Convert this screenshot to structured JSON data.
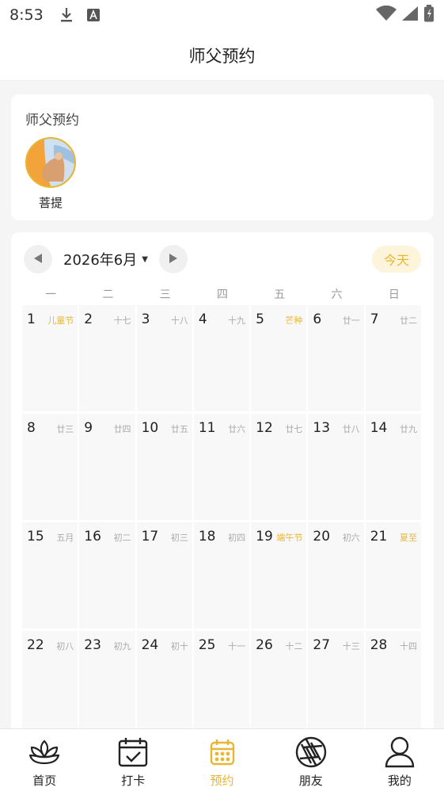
{
  "status_bar": {
    "time": "8:53",
    "icons": [
      "download-icon",
      "a-icon",
      "wifi-icon",
      "signal-icon",
      "battery-icon"
    ]
  },
  "header": {
    "title": "师父预约"
  },
  "master_section": {
    "title": "师父预约",
    "masters": [
      {
        "name": "菩提"
      }
    ]
  },
  "calendar": {
    "month_label": "2026年6月",
    "today_label": "今天",
    "weekdays": [
      "一",
      "二",
      "三",
      "四",
      "五",
      "六",
      "日"
    ],
    "weeks": [
      [
        {
          "day": "1",
          "lunar": "儿童节",
          "festival": true
        },
        {
          "day": "2",
          "lunar": "十七"
        },
        {
          "day": "3",
          "lunar": "十八"
        },
        {
          "day": "4",
          "lunar": "十九"
        },
        {
          "day": "5",
          "lunar": "芒种",
          "festival": true
        },
        {
          "day": "6",
          "lunar": "廿一"
        },
        {
          "day": "7",
          "lunar": "廿二"
        }
      ],
      [
        {
          "day": "8",
          "lunar": "廿三"
        },
        {
          "day": "9",
          "lunar": "廿四"
        },
        {
          "day": "10",
          "lunar": "廿五"
        },
        {
          "day": "11",
          "lunar": "廿六"
        },
        {
          "day": "12",
          "lunar": "廿七"
        },
        {
          "day": "13",
          "lunar": "廿八"
        },
        {
          "day": "14",
          "lunar": "廿九"
        }
      ],
      [
        {
          "day": "15",
          "lunar": "五月"
        },
        {
          "day": "16",
          "lunar": "初二"
        },
        {
          "day": "17",
          "lunar": "初三"
        },
        {
          "day": "18",
          "lunar": "初四"
        },
        {
          "day": "19",
          "lunar": "端午节",
          "festival": true
        },
        {
          "day": "20",
          "lunar": "初六"
        },
        {
          "day": "21",
          "lunar": "夏至",
          "festival": true
        }
      ],
      [
        {
          "day": "22",
          "lunar": "初八"
        },
        {
          "day": "23",
          "lunar": "初九"
        },
        {
          "day": "24",
          "lunar": "初十"
        },
        {
          "day": "25",
          "lunar": "十一"
        },
        {
          "day": "26",
          "lunar": "十二"
        },
        {
          "day": "27",
          "lunar": "十三"
        },
        {
          "day": "28",
          "lunar": "十四"
        }
      ]
    ]
  },
  "tab_bar": {
    "items": [
      {
        "label": "首页",
        "icon": "lotus-icon",
        "active": false
      },
      {
        "label": "打卡",
        "icon": "calendar-check-icon",
        "active": false
      },
      {
        "label": "预约",
        "icon": "calendar-icon",
        "active": true
      },
      {
        "label": "朋友",
        "icon": "aperture-icon",
        "active": false
      },
      {
        "label": "我的",
        "icon": "user-icon",
        "active": false
      }
    ]
  },
  "colors": {
    "accent": "#e8b630",
    "muted": "#aaaaaa"
  }
}
